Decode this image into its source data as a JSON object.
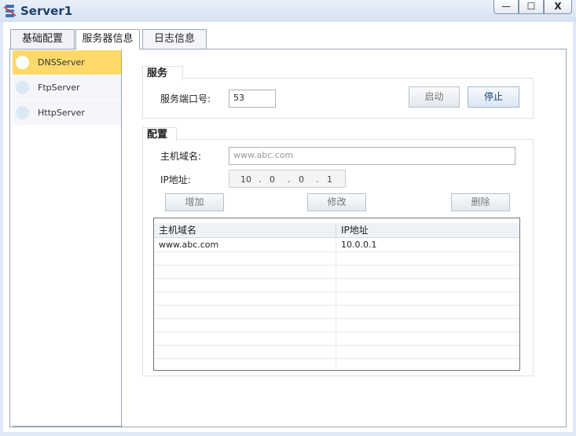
{
  "window": {
    "title": "Server1",
    "min": "—",
    "max": "☐",
    "close": "X"
  },
  "tabs": [
    "基础配置",
    "服务器信息",
    "日志信息"
  ],
  "sidebar": {
    "items": [
      {
        "label": "DNSServer"
      },
      {
        "label": "FtpServer"
      },
      {
        "label": "HttpServer"
      }
    ]
  },
  "service": {
    "title": "服务",
    "port_label": "服务端口号:",
    "port_value": "53",
    "start": "启动",
    "stop": "停止"
  },
  "config": {
    "title": "配置",
    "host_label": "主机域名:",
    "host_placeholder": "www.abc.com",
    "ip_label": "IP地址:",
    "ip_octets": [
      "10",
      "0",
      "0",
      "1"
    ],
    "ip_sep": ".",
    "add": "增加",
    "edit": "修改",
    "delete": "删除"
  },
  "table": {
    "columns": [
      "主机域名",
      "IP地址"
    ],
    "rows": [
      [
        "www.abc.com",
        "10.0.0.1"
      ],
      [
        "",
        ""
      ],
      [
        "",
        ""
      ],
      [
        "",
        ""
      ],
      [
        "",
        ""
      ],
      [
        "",
        ""
      ],
      [
        "",
        ""
      ],
      [
        "",
        ""
      ],
      [
        "",
        ""
      ],
      [
        "",
        ""
      ]
    ]
  },
  "colors": {
    "selected_item": "#fdd96a",
    "title_text": "#1f3f6e"
  }
}
